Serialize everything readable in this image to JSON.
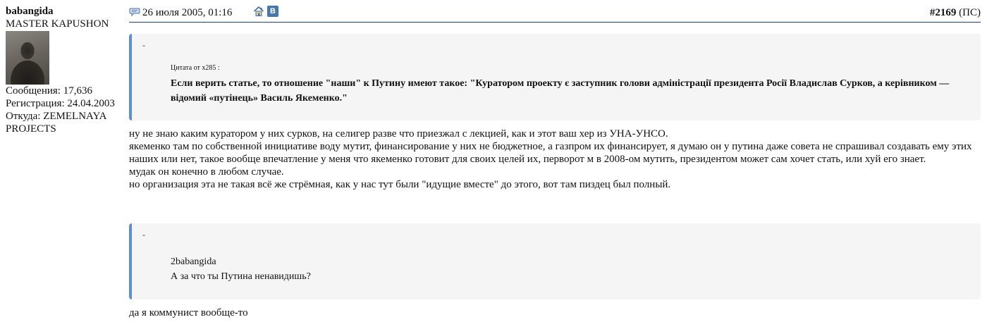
{
  "user": {
    "name": "babangida",
    "title": "MASTER KAPUSHON",
    "messages_label": "Сообщения: 17,636",
    "registered_label": "Регистрация: 24.04.2003",
    "location_label": "Откуда: ZEMELNAYA PROJECTS"
  },
  "header": {
    "date": "26 июля 2005, 01:16",
    "post_number": "#2169",
    "post_suffix": "(ПС)",
    "vk_label": "B"
  },
  "quotes": [
    {
      "dash": "-",
      "author": "Цитата от x285 :",
      "text": "Если верить статье, то отношение \"наши\" к Путину имеют такое: \"Куратором проекту є заступник голови адміністрації президента Росії Владислав Сурков, а керівником — відомий «путінець» Василь Якеменко.\""
    },
    {
      "dash": "-",
      "lines": [
        "2babangida",
        "А за что ты Путина ненавидишь?"
      ]
    }
  ],
  "messages": [
    {
      "lines": [
        "ну не знаю каким куратором у них сурков, на селигер разве что приезжал с лекцией, как и этот ваш хер из УНА-УНСО.",
        "якеменко там по собственной инициативе воду мутит, финансирование у них не бюджетное, а газпром их финансирует, я думаю он у путина даже совета не спрашивал создавать ему этих наших или нет, такое вообще впечатление у меня что якеменко готовит для своих целей их, перворот м в 2008-ом мутить, президентом может сам хочет стать, или хуй его знает.",
        "мудак он конечно в любом случае.",
        "но организация эта не такая всё же стрёмная, как у нас тут были \"идущие вместе\" до этого, вот там пиздец был полный."
      ]
    },
    {
      "lines": [
        "да я коммунист вообще-то"
      ]
    }
  ],
  "colors": {
    "quote_border": "#5b8fd6",
    "quote_background": "#f5f5f5",
    "header_rule": "#1f3f6e",
    "vk_blue": "#4a76a8"
  },
  "icons": {
    "post": "speech-bubble-icon",
    "home": "home-icon",
    "vk": "vk-icon"
  }
}
